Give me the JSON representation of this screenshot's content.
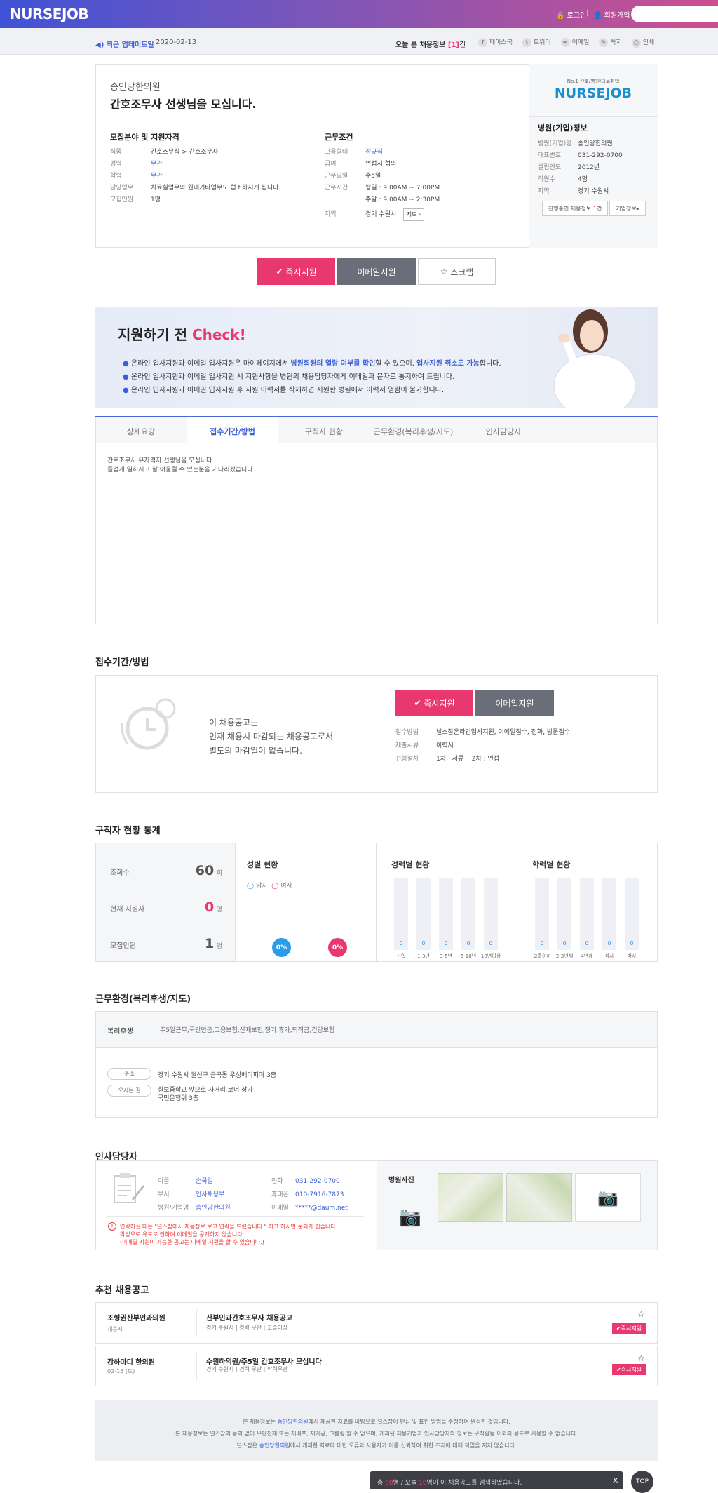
{
  "header": {
    "logo": "NURSEJOB",
    "login": "로그인",
    "signup": "회원가입"
  },
  "subbar": {
    "update_label": "최근 업데이트일",
    "update_date": "2020-02-13",
    "today_label": "오늘 본 채용정보",
    "today_count": "1",
    "today_unit": "건",
    "share": [
      "페이스북",
      "트위터",
      "이메일",
      "쪽지",
      "인쇄"
    ]
  },
  "job": {
    "hospital": "송인당한의원",
    "title": "간호조무사 선생님을 모십니다.",
    "recruit_title": "모집분야 및 지원자격",
    "recruit": [
      {
        "k": "직종",
        "v": "간호조무직 > 간호조무사"
      },
      {
        "k": "경력",
        "v": "무관"
      },
      {
        "k": "학력",
        "v": "무관"
      },
      {
        "k": "담당업무",
        "v": "치료실업무와 원내기타업무도 협조하시게 됩니다."
      },
      {
        "k": "모집인원",
        "v": "1명"
      }
    ],
    "cond_title": "근무조건",
    "cond": [
      {
        "k": "고용형태",
        "v": "정규직"
      },
      {
        "k": "급여",
        "v": "면접시 협의"
      },
      {
        "k": "근무요일",
        "v": "주5일"
      },
      {
        "k": "근무시간",
        "v": "평일 : 9:00AM ~ 7:00PM"
      },
      {
        "k": "",
        "v": "주말 : 9:00AM ~ 2:30PM"
      },
      {
        "k": "지역",
        "v": "경기 수원시"
      }
    ],
    "map_btn": "지도"
  },
  "side": {
    "tag": "No.1 간호/병원/의료취업",
    "logo": "NURSEJOB",
    "title": "병원(기업)정보",
    "rows": [
      {
        "k": "병원(기업)명",
        "v": "송인당한의원"
      },
      {
        "k": "대표번호",
        "v": "031-292-0700"
      },
      {
        "k": "설립연도",
        "v": "2012년"
      },
      {
        "k": "직원수",
        "v": "4명"
      },
      {
        "k": "지역",
        "v": "경기 수원시"
      }
    ],
    "ongoing_a": "진행중인 채용정보",
    "ongoing_n": "1",
    "ongoing_b": "건",
    "company_btn": "기업정보"
  },
  "actions": {
    "apply": "즉시지원",
    "email": "이메일지원",
    "scrap": "스크랩"
  },
  "check": {
    "title": "지원하기 전",
    "title_hl": "Check!",
    "l1a": "온라인 입사지원과 이메일 입사지원은 마이페이지에서 ",
    "l1b": "병원회원의 열람 여부를 확인",
    "l1c": "할 수 있으며, ",
    "l1d": "입사지원 취소도 가능",
    "l1e": "합니다.",
    "l2": "온라인 입사지원과 이메일 입사지원 시 지원사항을 병원의 채용담당자에게 이메일과 문자로 통지하여 드립니다.",
    "l3": "온라인 입사지원과 이메일 입사지원 후 지원 이력서를 삭제하면 지원한 병원에서 이력서 열람이 불가합니다."
  },
  "tabs": [
    "상세요강",
    "접수기간/방법",
    "구직자 현황",
    "근무환경(복리후생/지도)",
    "인사담당자"
  ],
  "detail": {
    "l1": "간호조무사 유자격자 선생님을 모십니다.",
    "l2": "즐겁게 일하시고 잘 어울릴 수 있는분을 기다리겠습니다."
  },
  "period": {
    "title": "접수기간/방법",
    "msg1": "이 채용공고는",
    "msg2": "인재 채용시 마감되는 채용공고로서",
    "msg3": "별도의 마감일이 없습니다.",
    "rows": [
      {
        "k": "접수방법",
        "v": "널스잡온라인입사지원, 이메일접수, 전화, 방문접수"
      },
      {
        "k": "제출서류",
        "v": "이력서"
      },
      {
        "k": "전형절차",
        "v": "1차 : 서류    2차 : 면접"
      }
    ]
  },
  "stats": {
    "title": "구직자 현황 통계",
    "views_label": "조회수",
    "views": "60",
    "views_unit": "회",
    "applicants_label": "현재 지원자",
    "applicants": "0",
    "applicants_unit": "명",
    "recruit_label": "모집인원",
    "recruit": "1",
    "recruit_unit": "명",
    "gender_title": "성별 현황",
    "male": "남자",
    "female": "여자",
    "male_pct": "0%",
    "female_pct": "0%",
    "career_title": "경력별 현황",
    "career_cats": [
      "신입",
      "1-3년",
      "3-5년",
      "5-10년",
      "10년이상"
    ],
    "career_vals": [
      "0",
      "0",
      "0",
      "0",
      "0"
    ],
    "edu_title": "학력별 현황",
    "edu_cats": [
      "고졸이하",
      "2-3년제",
      "4년제",
      "석사",
      "박사"
    ],
    "edu_vals": [
      "0",
      "0",
      "0",
      "0",
      "0"
    ]
  },
  "env": {
    "title": "근무환경(복리후생/지도)",
    "welfare_label": "복리후생",
    "welfare": "주5일근무,국민연금,고용보험,산재보험,정기 휴가,퇴직금,건강보험",
    "addr_label": "주소",
    "addr": "경기 수원시 권선구 금곡동 우성메디피아 3층",
    "way_label": "오시는 길",
    "way1": "칠보중학교 앞으로 사거리 코너 상가",
    "way2": "국민은행위 3층"
  },
  "hr": {
    "title": "인사담당자",
    "rows": [
      {
        "k": "이름",
        "v": "손국일",
        "k2": "전화",
        "v2": "031-292-0700"
      },
      {
        "k": "부서",
        "v": "인사채용부",
        "k2": "휴대폰",
        "v2": "010-7916-7873"
      },
      {
        "k": "병원/기업명",
        "v": "송인당한의원",
        "k2": "이메일",
        "v2": "*****@daum.net"
      }
    ],
    "warn1": "연락하실 때는 \"널스잡에서 채용정보 보고 연락을 드렸습니다.\" 하고 하시면 문의가 쉽습니다.",
    "warn2": "악성으로 유포로 인하여 이메일을 공개하지 않습니다.",
    "warn3": "(이메일 지원이 가능한 공고는 이메일 지원을 할 수 있습니다.)",
    "photo_title": "병원사진"
  },
  "recommend": {
    "title": "추천 채용공고",
    "items": [
      {
        "hospital": "조형권산부인과의원",
        "sub": "채용시",
        "title": "산부인과간호조무사 채용공고",
        "loc": "경기 수원시",
        "career": "경력 무관",
        "edu": "고졸이상",
        "btn": "즉시지원"
      },
      {
        "hospital": "강하마디 한의원",
        "sub": "02-15 (토)",
        "title": "수원하의원/주5일 간호조무사 모십니다",
        "loc": "경기 수원시",
        "career": "경력 무관",
        "edu": "학력무관",
        "btn": "즉시지원"
      }
    ]
  },
  "footer": {
    "l1a": "본 채용정보는 ",
    "l1b": "송인당한의원",
    "l1c": "에서 제공한 자료를 바탕으로 널스잡이 편집 및 표현 방법을 수정하여 완성한 것입니다.",
    "l2": "본 채용정보는 널스잡의 동의 없이 무단전재 또는 재배포, 재가공, 크롤링 할 수 없으며, 게재된 채용기업과 인사담당자의 정보는 구직활동 이외의 용도로 사용할 수 없습니다.",
    "l3a": "널스잡은 ",
    "l3b": "송인당한의원",
    "l3c": "에서 게재한 자료에 대한 오류와 사용자가 이를 신뢰하여 취한 조치에 대해 책임을 지지 않습니다."
  },
  "bottom": {
    "a": "총 ",
    "total": "60",
    "b": "명 / 오늘 ",
    "today": "10",
    "c": "명이 이 채용공고를 검색하였습니다.",
    "close": "X",
    "top": "TOP"
  }
}
